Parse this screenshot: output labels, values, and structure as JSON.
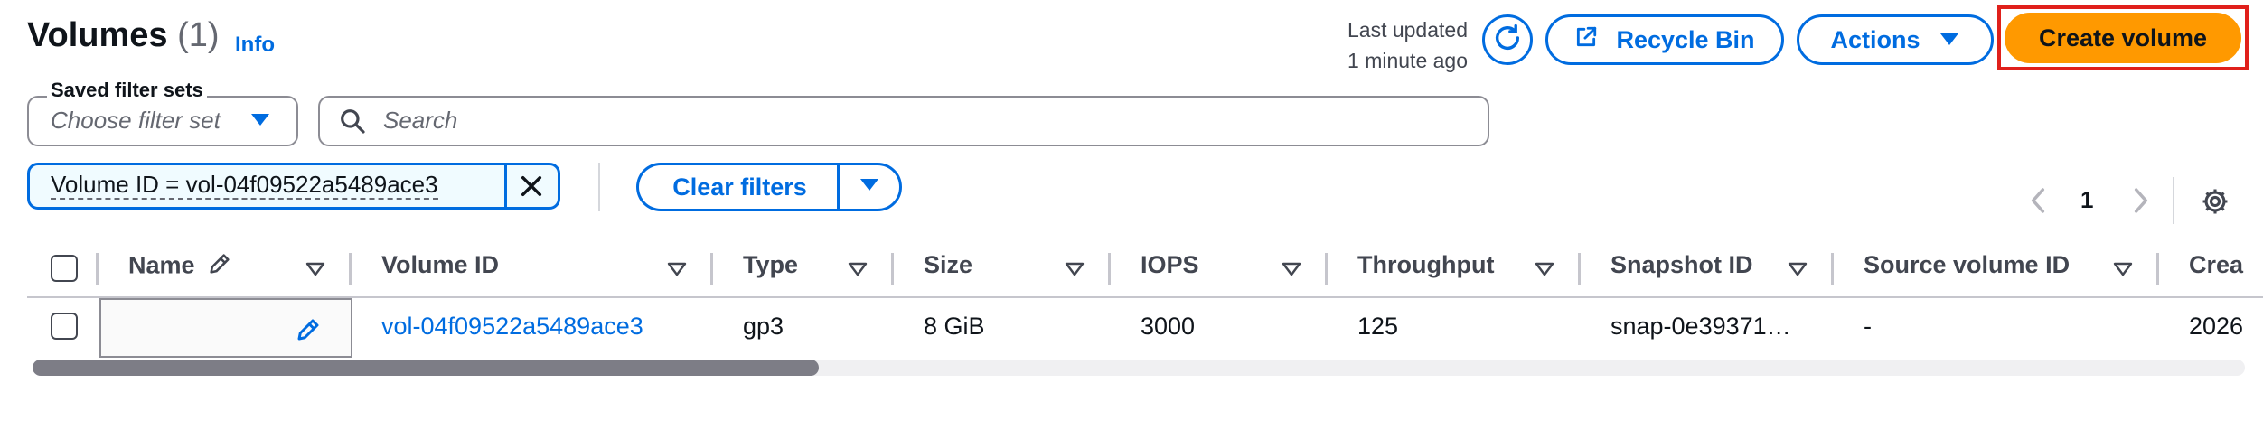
{
  "header": {
    "title": "Volumes",
    "count": "(1)",
    "info": "Info",
    "last_updated_line1": "Last updated",
    "last_updated_line2": "1 minute ago"
  },
  "toolbar": {
    "recycle_bin_label": "Recycle Bin",
    "actions_label": "Actions",
    "create_volume_label": "Create volume"
  },
  "filters": {
    "saved_filter_sets_label": "Saved filter sets",
    "saved_filter_sets_placeholder": "Choose filter set",
    "search_placeholder": "Search",
    "token_text": "Volume ID = vol-04f09522a5489ace3",
    "clear_filters_label": "Clear filters"
  },
  "pagination": {
    "current_page": "1"
  },
  "table": {
    "columns": [
      {
        "label": "Name"
      },
      {
        "label": "Volume ID"
      },
      {
        "label": "Type"
      },
      {
        "label": "Size"
      },
      {
        "label": "IOPS"
      },
      {
        "label": "Throughput"
      },
      {
        "label": "Snapshot ID"
      },
      {
        "label": "Source volume ID"
      },
      {
        "label": "Crea"
      }
    ],
    "rows": [
      {
        "name": "",
        "volume_id": "vol-04f09522a5489ace3",
        "type": "gp3",
        "size": "8 GiB",
        "iops": "3000",
        "throughput": "125",
        "snapshot_id": "snap-0e39371…",
        "source_volume_id": "-",
        "created": "2026"
      }
    ]
  },
  "scrollbar": {
    "position_fraction": 0.0,
    "visible_fraction": 0.36
  },
  "colors": {
    "link": "#006ce0",
    "primary_button": "#ff9900",
    "highlight_outline": "#e0201b",
    "text": "#0f141a",
    "muted_text": "#656871"
  },
  "icons": [
    "refresh-icon",
    "external-link-icon",
    "caret-down-icon",
    "search-icon",
    "close-icon",
    "chevron-left-icon",
    "chevron-right-icon",
    "gear-icon",
    "pencil-icon"
  ]
}
